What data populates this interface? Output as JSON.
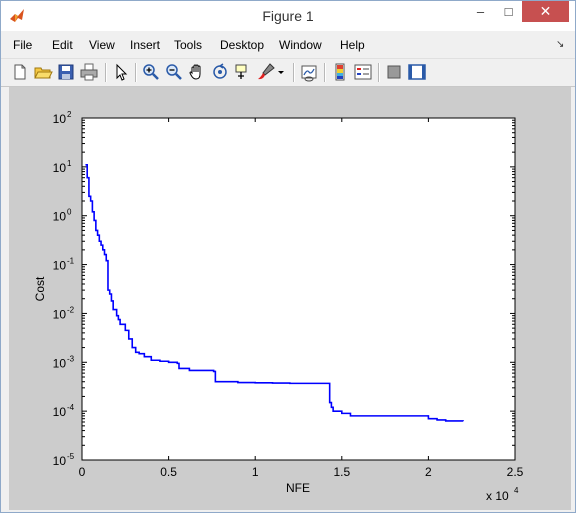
{
  "window": {
    "title": "Figure 1"
  },
  "menu": [
    "File",
    "Edit",
    "View",
    "Insert",
    "Tools",
    "Desktop",
    "Window",
    "Help"
  ],
  "toolbar": {
    "buttons": [
      "new-figure",
      "open-file",
      "save",
      "print",
      "edit-plot",
      "zoom-in",
      "zoom-out",
      "pan",
      "data-cursor",
      "brush",
      "link-plot",
      "insert-colorbar",
      "insert-legend",
      "hide-plot-tools",
      "show-plot-tools"
    ]
  },
  "chart_data": {
    "type": "line",
    "xlabel": "NFE",
    "ylabel": "Cost",
    "x_multiplier_label": "x 10",
    "x_multiplier_exp": "4",
    "xlim": [
      0,
      25000
    ],
    "ylim_log10": [
      -5,
      2
    ],
    "y_scale": "log",
    "grid": false,
    "xticks": [
      0,
      5000,
      10000,
      15000,
      20000,
      25000
    ],
    "xtick_labels": [
      "0",
      "0.5",
      "1",
      "1.5",
      "2",
      "2.5"
    ],
    "yticks_exp": [
      "2",
      "1",
      "0",
      "-1",
      "-2",
      "-3",
      "-4",
      "-5"
    ],
    "ytick_base": "10",
    "series": [
      {
        "color": "#0000ff",
        "x": [
          200,
          300,
          400,
          500,
          600,
          700,
          800,
          900,
          1000,
          1100,
          1200,
          1300,
          1400,
          1500,
          1600,
          1700,
          1800,
          1900,
          2000,
          2100,
          2200,
          2300,
          2500,
          2700,
          2900,
          3100,
          3300,
          3600,
          4000,
          4500,
          5000,
          5500,
          5600,
          6200,
          7600,
          7700,
          8000,
          9000,
          10000,
          11000,
          12000,
          13000,
          14200,
          14300,
          14400,
          14500,
          15000,
          15500,
          16000,
          17000,
          18000,
          19000,
          19900,
          20000,
          20500,
          21000,
          22000
        ],
        "y": [
          11,
          6,
          2.5,
          2,
          1.2,
          0.8,
          0.5,
          0.4,
          0.3,
          0.25,
          0.2,
          0.16,
          0.12,
          0.03,
          0.025,
          0.018,
          0.012,
          0.012,
          0.009,
          0.0075,
          0.006,
          0.006,
          0.0045,
          0.003,
          0.002,
          0.0016,
          0.0015,
          0.0013,
          0.0011,
          0.00105,
          0.001,
          0.00095,
          0.00075,
          0.00068,
          0.00065,
          0.0004,
          0.0004,
          0.000385,
          0.00038,
          0.000375,
          0.00037,
          0.00037,
          0.00037,
          0.00015,
          0.00012,
          0.0001,
          9e-05,
          8e-05,
          8e-05,
          8e-05,
          8e-05,
          8e-05,
          8e-05,
          7e-05,
          6.6e-05,
          6.3e-05,
          6.2e-05
        ]
      }
    ]
  }
}
